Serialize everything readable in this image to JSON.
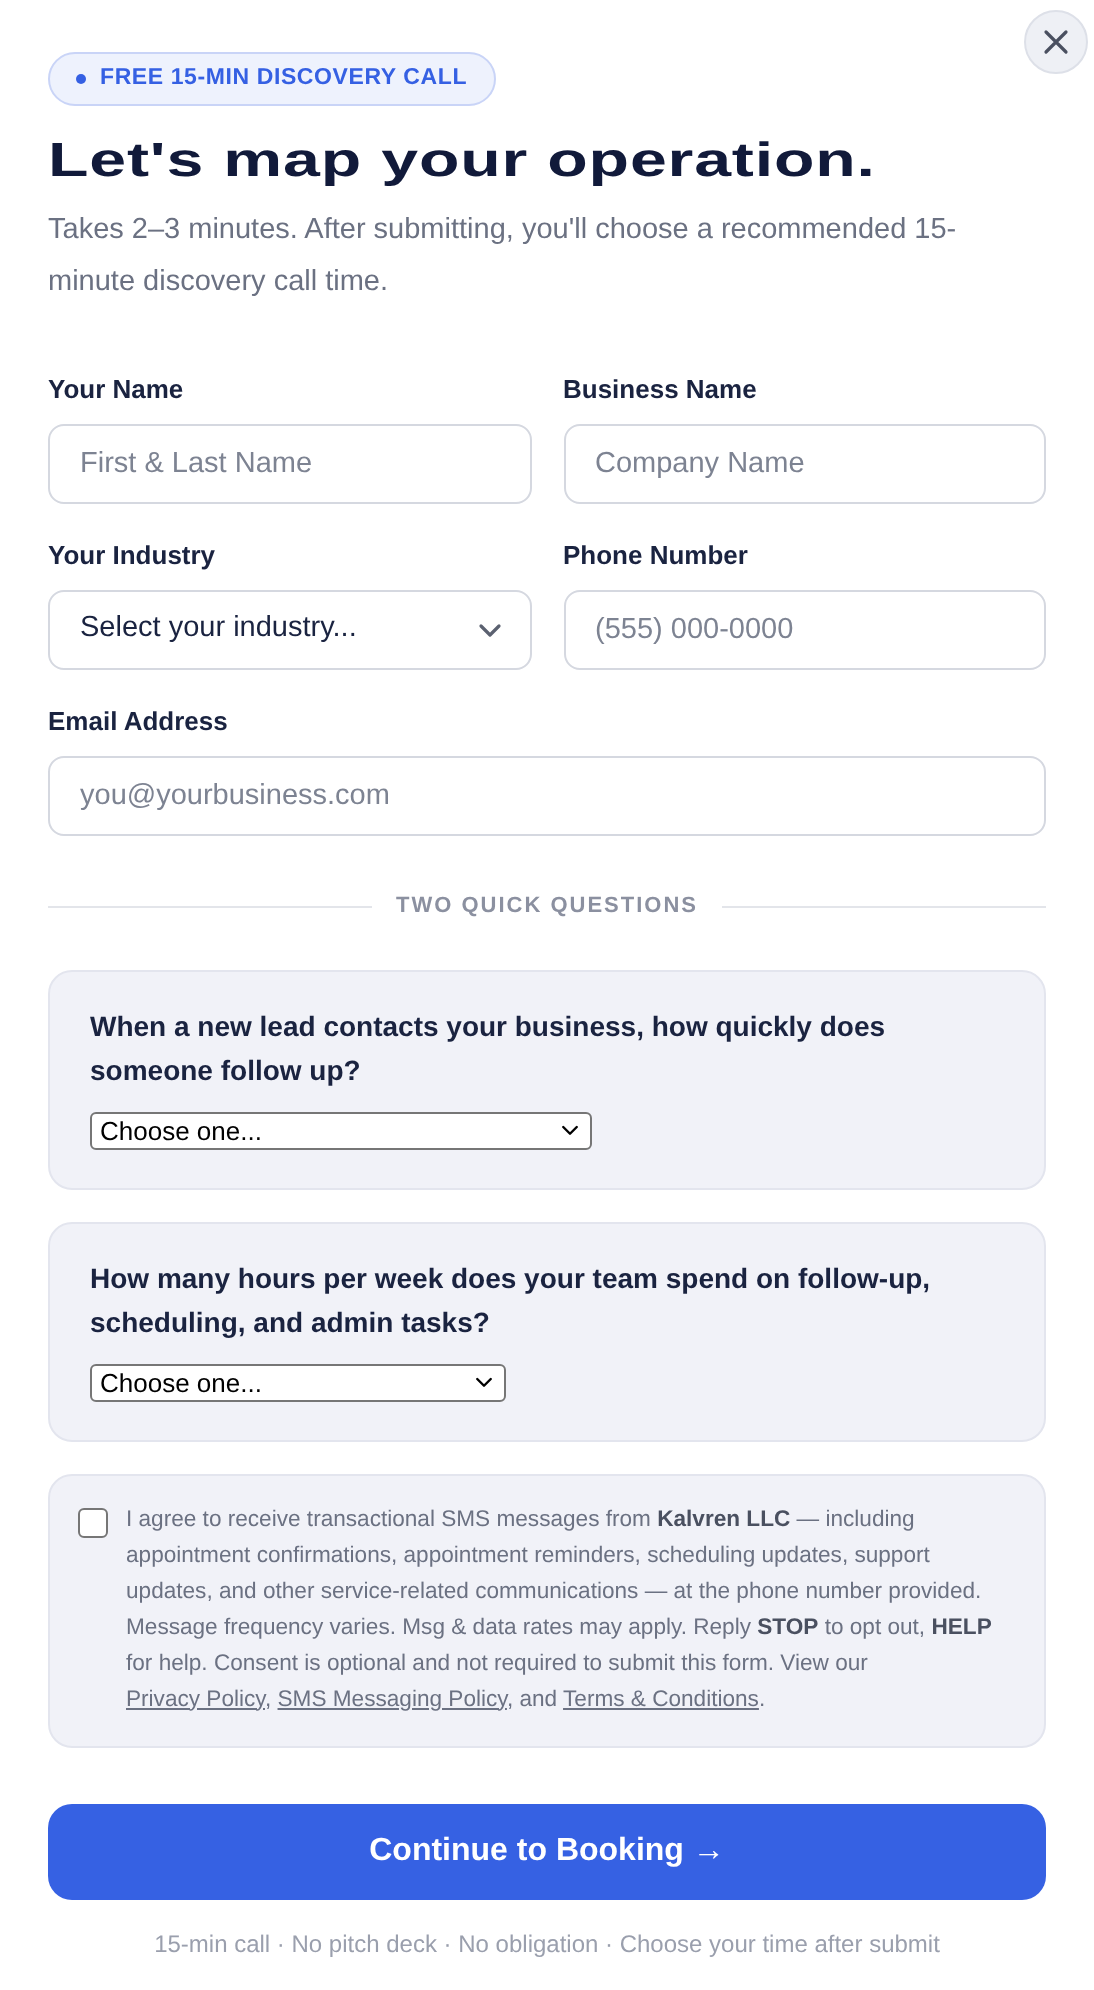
{
  "badge": "FREE 15-MIN DISCOVERY CALL",
  "title": "Let's map your operation.",
  "subtitle": "Takes 2–3 minutes. After submitting, you'll choose a recommended 15-minute discovery call time.",
  "field_rows": [
    [
      {
        "label": "Your Name",
        "kind": "input",
        "placeholder": "First & Last Name"
      },
      {
        "label": "Business Name",
        "kind": "input",
        "placeholder": "Company Name"
      }
    ],
    [
      {
        "label": "Your Industry",
        "kind": "select",
        "placeholder": "Select your industry..."
      },
      {
        "label": "Phone Number",
        "kind": "input",
        "placeholder": "(555) 000-0000"
      }
    ],
    [
      {
        "label": "Email Address",
        "kind": "input",
        "placeholder": "you@yourbusiness.com"
      }
    ]
  ],
  "section_divider": "TWO QUICK QUESTIONS",
  "questions": [
    {
      "question": "When a new lead contacts your business, how quickly does someone follow up?",
      "value": "Choose one..."
    },
    {
      "question": "How many hours per week does your team spend on follow-up, scheduling, and admin tasks?",
      "value": "Choose one..."
    }
  ],
  "consent": {
    "checked": false,
    "segments": [
      {
        "kind": "text",
        "text": "I agree to receive transactional SMS messages from **Kalvren LLC** — including appointment confirmations, appointment reminders, scheduling updates, support updates, and other service-related communications — at the phone number provided. Message frequency varies. Msg & data rates may apply. Reply **STOP** to opt out, **HELP** for help. Consent is optional and not required to submit this form. View our "
      },
      {
        "kind": "link",
        "text": "Privacy Policy"
      },
      {
        "kind": "text",
        "text": ", "
      },
      {
        "kind": "link",
        "text": "SMS Messaging Policy"
      },
      {
        "kind": "text",
        "text": ", and "
      },
      {
        "kind": "link",
        "text": "Terms & Conditions"
      },
      {
        "kind": "text",
        "text": "."
      }
    ]
  },
  "submit_button": "Continue to Booking →",
  "footer_note": "15-min call · No pitch deck · No obligation · Choose your time after submit"
}
